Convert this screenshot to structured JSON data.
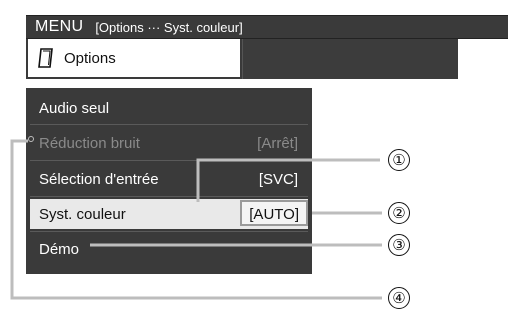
{
  "header": {
    "menu_label": "MENU",
    "breadcrumb": "[Options ··· Syst. couleur]"
  },
  "tab": {
    "label": "Options",
    "icon": "notepad-icon"
  },
  "menu": {
    "items": [
      {
        "label": "Audio seul",
        "value": "",
        "state": "normal"
      },
      {
        "label": "Réduction bruit",
        "value": "[Arrêt]",
        "state": "disabled"
      },
      {
        "label": "Sélection d'entrée",
        "value": "[SVC]",
        "state": "normal"
      },
      {
        "label": "Syst. couleur",
        "value": "[AUTO]",
        "state": "selected"
      },
      {
        "label": "Démo",
        "value": "",
        "state": "normal"
      }
    ]
  },
  "callouts": [
    "①",
    "②",
    "③",
    "④"
  ],
  "colors": {
    "panel_bg": "#3a3a3a",
    "selected_bg": "#e9e9e9",
    "disabled_text": "#8a8a8a",
    "callout_line": "#bdbdbd"
  }
}
